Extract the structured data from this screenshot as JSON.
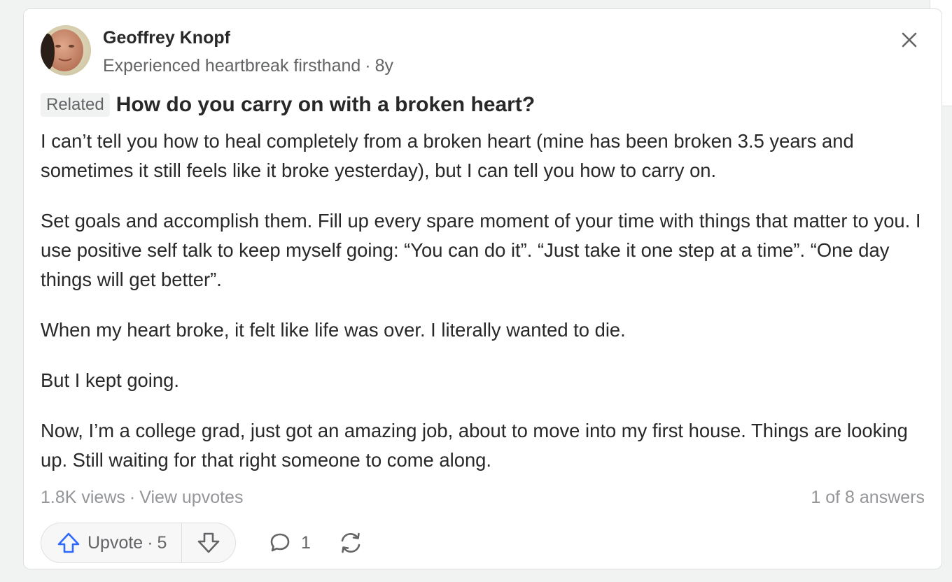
{
  "author": {
    "name": "Geoffrey Knopf",
    "credential": "Experienced heartbreak firsthand",
    "time_ago": "8y",
    "avatar_icon": "user-avatar"
  },
  "question": {
    "badge": "Related",
    "title": "How do you carry on with a broken heart?"
  },
  "answer": {
    "paragraphs": [
      "I can’t tell you how to heal completely from a broken heart (mine has been broken 3.5 years and sometimes it still feels like it broke yesterday), but I can tell you how to carry on.",
      "Set goals and accomplish them. Fill up every spare moment of your time with things that matter to you. I use positive self talk to keep myself going: “You can do it”. “Just take it one step at a time”. “One day things will get better”.",
      "When my heart broke, it felt like life was over. I literally wanted to die.",
      "But I kept going.",
      "Now, I’m a college grad, just got an amazing job, about to move into my first house. Things are looking up. Still waiting for that right someone to come along."
    ]
  },
  "footer": {
    "views": "1.8K views",
    "view_upvotes": "View upvotes",
    "answer_position": "1 of 8 answers"
  },
  "actions": {
    "upvote_label": "Upvote",
    "upvote_count": "5",
    "comment_count": "1"
  },
  "icons": {
    "close": "close-icon",
    "upvote": "arrow-up-icon",
    "downvote": "arrow-down-icon",
    "comment": "comment-bubble-icon",
    "share": "share-refresh-icon"
  },
  "colors": {
    "accent_blue": "#2e69ff",
    "text_primary": "#282829",
    "text_secondary": "#636466",
    "text_muted": "#939598",
    "border": "#dee0e1",
    "badge_bg": "#f1f2f2"
  }
}
